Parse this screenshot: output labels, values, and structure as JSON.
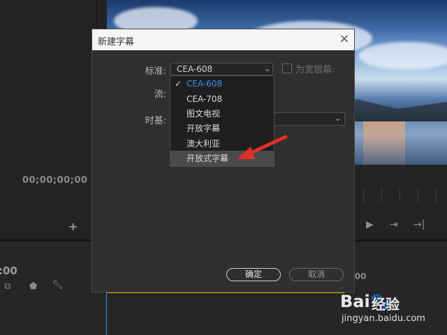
{
  "background": {
    "timecode_left": "00;00;00;00",
    "timecode_bottom": ":00",
    "timecode_right": ":00",
    "add_icon": "+",
    "monitor_controls": [
      "▶",
      "⇥",
      "→|"
    ]
  },
  "dialog": {
    "title": "新建字幕",
    "close_label": "×",
    "standard_label": "标准:",
    "standard_value": "CEA-608",
    "stream_label": "流:",
    "timebase_label": "时基:",
    "widescreen_label": "为宽银幕:",
    "ok_label": "确定",
    "cancel_label": "取消"
  },
  "dropdown": {
    "check_mark": "✓",
    "options": [
      "CEA-608",
      "CEA-708",
      "图文电视",
      "开放字幕",
      "澳大利亚",
      "开放式字幕"
    ],
    "selected": "CEA-608",
    "highlighted": "开放式字幕"
  },
  "watermark": {
    "logo": "Bai🐾",
    "text": "经验",
    "url": "jingyan.baidu.com"
  },
  "colors": {
    "accent": "#3a8eea",
    "arrow": "#e0302a",
    "dialog_bg": "#2f2f2f"
  }
}
